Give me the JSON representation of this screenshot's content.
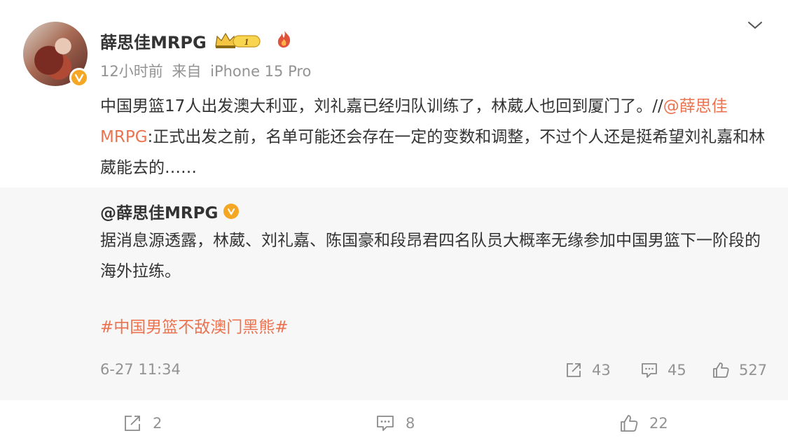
{
  "post": {
    "username": "薛思佳MRPG",
    "time": "12小时前",
    "source_prefix": "来自",
    "source_device": "iPhone 15 Pro",
    "text_main": "中国男篮17人出发澳大利亚，刘礼嘉已经归队训练了，林葳人也回到厦门了。//",
    "mention": "@薛思佳MRPG",
    "text_quote": ":正式出发之前，名单可能还会存在一定的变数和调整，不过个人还是挺希望刘礼嘉和林葳能去的……",
    "crown_badge_level": "1"
  },
  "repost": {
    "username": "@薛思佳MRPG",
    "text": "据消息源透露，林葳、刘礼嘉、陈国豪和段昂君四名队员大概率无缘参加中国男篮下一阶段的海外拉练。",
    "hashtag": "#中国男篮不敌澳门黑熊#",
    "timestamp": "6-27 11:34",
    "shares": "43",
    "comments": "45",
    "likes": "527"
  },
  "bottom_bar": {
    "shares": "2",
    "comments": "8",
    "likes": "22"
  },
  "colors": {
    "accent": "#eb7350",
    "muted": "#939393",
    "verified": "#f5a623",
    "repost_bg": "#f7f7f7"
  },
  "icons": {
    "share": "share-icon",
    "comment": "comment-icon",
    "like": "thumbs-up-icon",
    "more": "chevron-down-icon"
  }
}
